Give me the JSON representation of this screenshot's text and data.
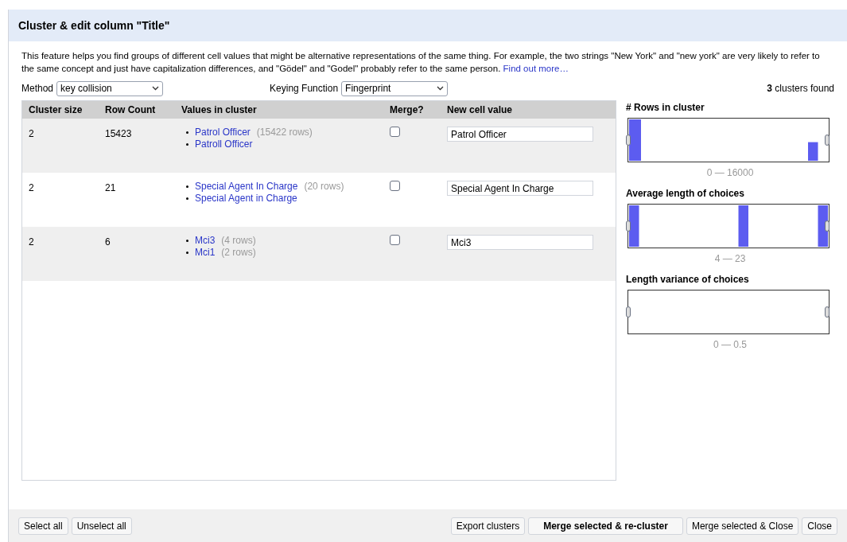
{
  "dialog": {
    "title": "Cluster & edit column \"Title\""
  },
  "description": "This feature helps you find groups of different cell values that might be alternative representations of the same thing. For example, the two strings \"New York\" and \"new york\" are very likely to refer to the same concept and just have capitalization differences, and \"Gödel\" and \"Godel\" probably refer to the same person.",
  "help_link": "Find out more…",
  "method": {
    "label": "Method",
    "value": "key collision"
  },
  "keying_function": {
    "label": "Keying Function",
    "value": "Fingerprint"
  },
  "clusters_found": {
    "count": "3",
    "text": "clusters found"
  },
  "table": {
    "columns": [
      "Cluster size",
      "Row Count",
      "Values in cluster",
      "Merge?",
      "New cell value"
    ],
    "rows": [
      {
        "cluster_size": "2",
        "row_count": "15423",
        "values": [
          {
            "value": "Patrol Officer",
            "rows": "(15422 rows)"
          },
          {
            "value": "Patroll Officer"
          }
        ],
        "merge": false,
        "new_value": "Patrol Officer"
      },
      {
        "cluster_size": "2",
        "row_count": "21",
        "values": [
          {
            "value": "Special Agent In Charge",
            "rows": "(20 rows)"
          },
          {
            "value": "Special Agent in Charge"
          }
        ],
        "merge": false,
        "new_value": "Special Agent In Charge"
      },
      {
        "cluster_size": "2",
        "row_count": "6",
        "values": [
          {
            "value": "Mci3",
            "rows": "(4 rows)"
          },
          {
            "value": "Mci1",
            "rows": "(2 rows)"
          }
        ],
        "merge": false,
        "new_value": "Mci3"
      }
    ]
  },
  "facets": [
    {
      "title": "# Rows in cluster",
      "range": "0 — 16000"
    },
    {
      "title": "Average length of choices",
      "range": "4 — 23"
    },
    {
      "title": "Length variance of choices",
      "range": "0 — 0.5"
    }
  ],
  "buttons_left": [
    "Select all",
    "Unselect all"
  ],
  "buttons_right": [
    {
      "label": "Export clusters",
      "primary": false
    },
    {
      "label": "Merge selected & re-cluster",
      "primary": true
    },
    {
      "label": "Merge selected & Close",
      "primary": false
    },
    {
      "label": "Close",
      "primary": false
    }
  ]
}
